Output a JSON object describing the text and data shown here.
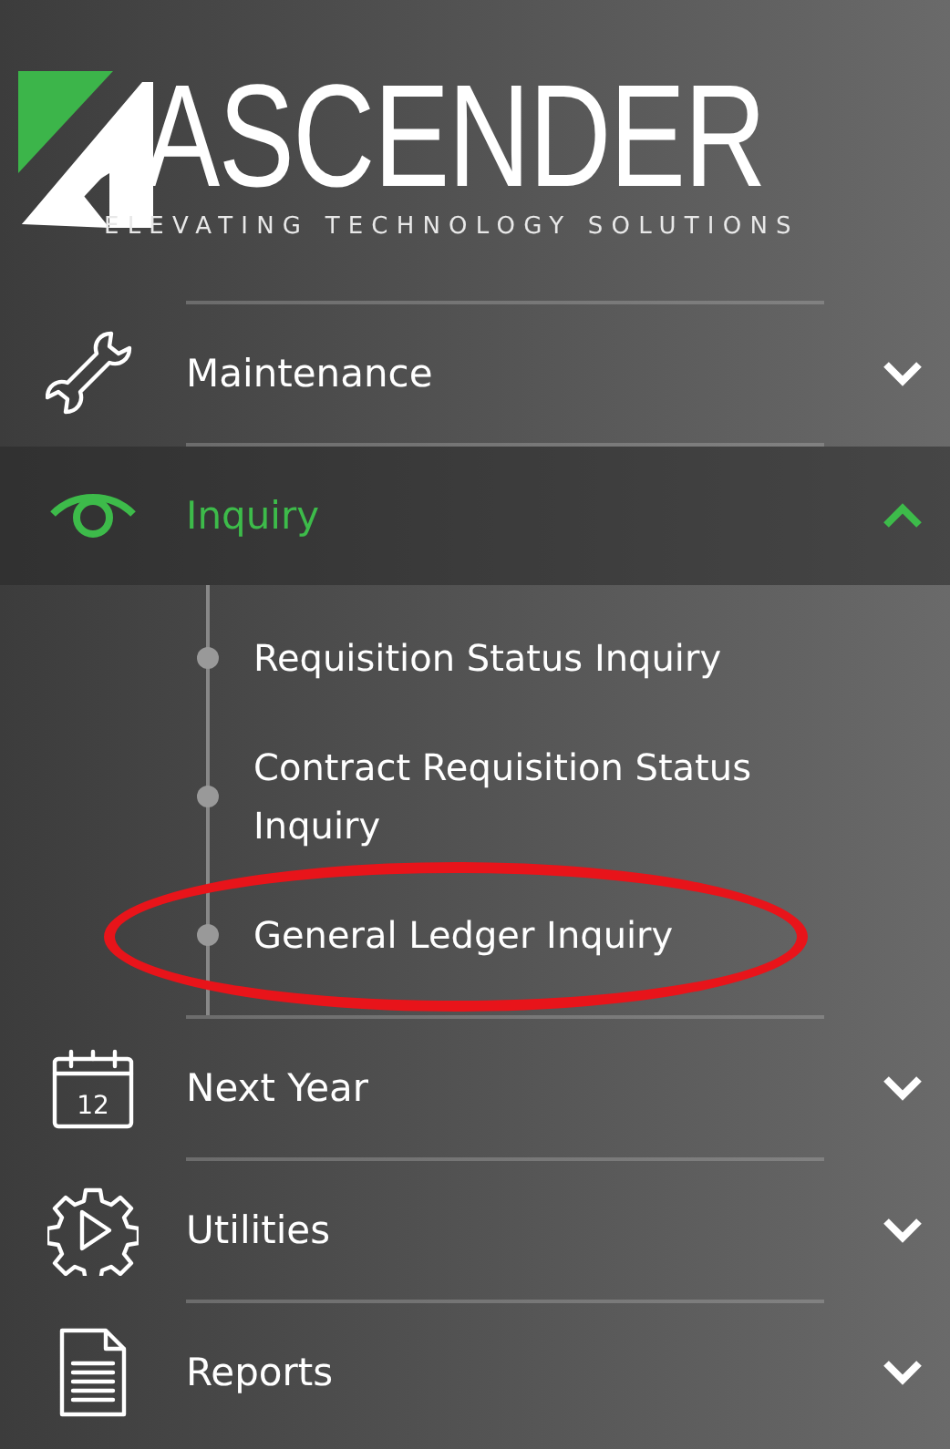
{
  "logo": {
    "name": "ASCENDER",
    "tagline": "ELEVATING TECHNOLOGY SOLUTIONS"
  },
  "menu": [
    {
      "label": "Maintenance",
      "kind": "wrench",
      "expanded": false,
      "selected": false
    },
    {
      "label": "Inquiry",
      "kind": "eye",
      "expanded": true,
      "selected": true,
      "children": [
        {
          "label": "Requisition Status Inquiry",
          "highlighted": false
        },
        {
          "label": "Contract Requisition Status Inquiry",
          "highlighted": false
        },
        {
          "label": "General Ledger Inquiry",
          "highlighted": true
        }
      ]
    },
    {
      "label": "Next Year",
      "kind": "calendar",
      "icon_text": "12",
      "expanded": false,
      "selected": false
    },
    {
      "label": "Utilities",
      "kind": "gear",
      "expanded": false,
      "selected": false
    },
    {
      "label": "Reports",
      "kind": "document",
      "expanded": false,
      "selected": false
    }
  ]
}
